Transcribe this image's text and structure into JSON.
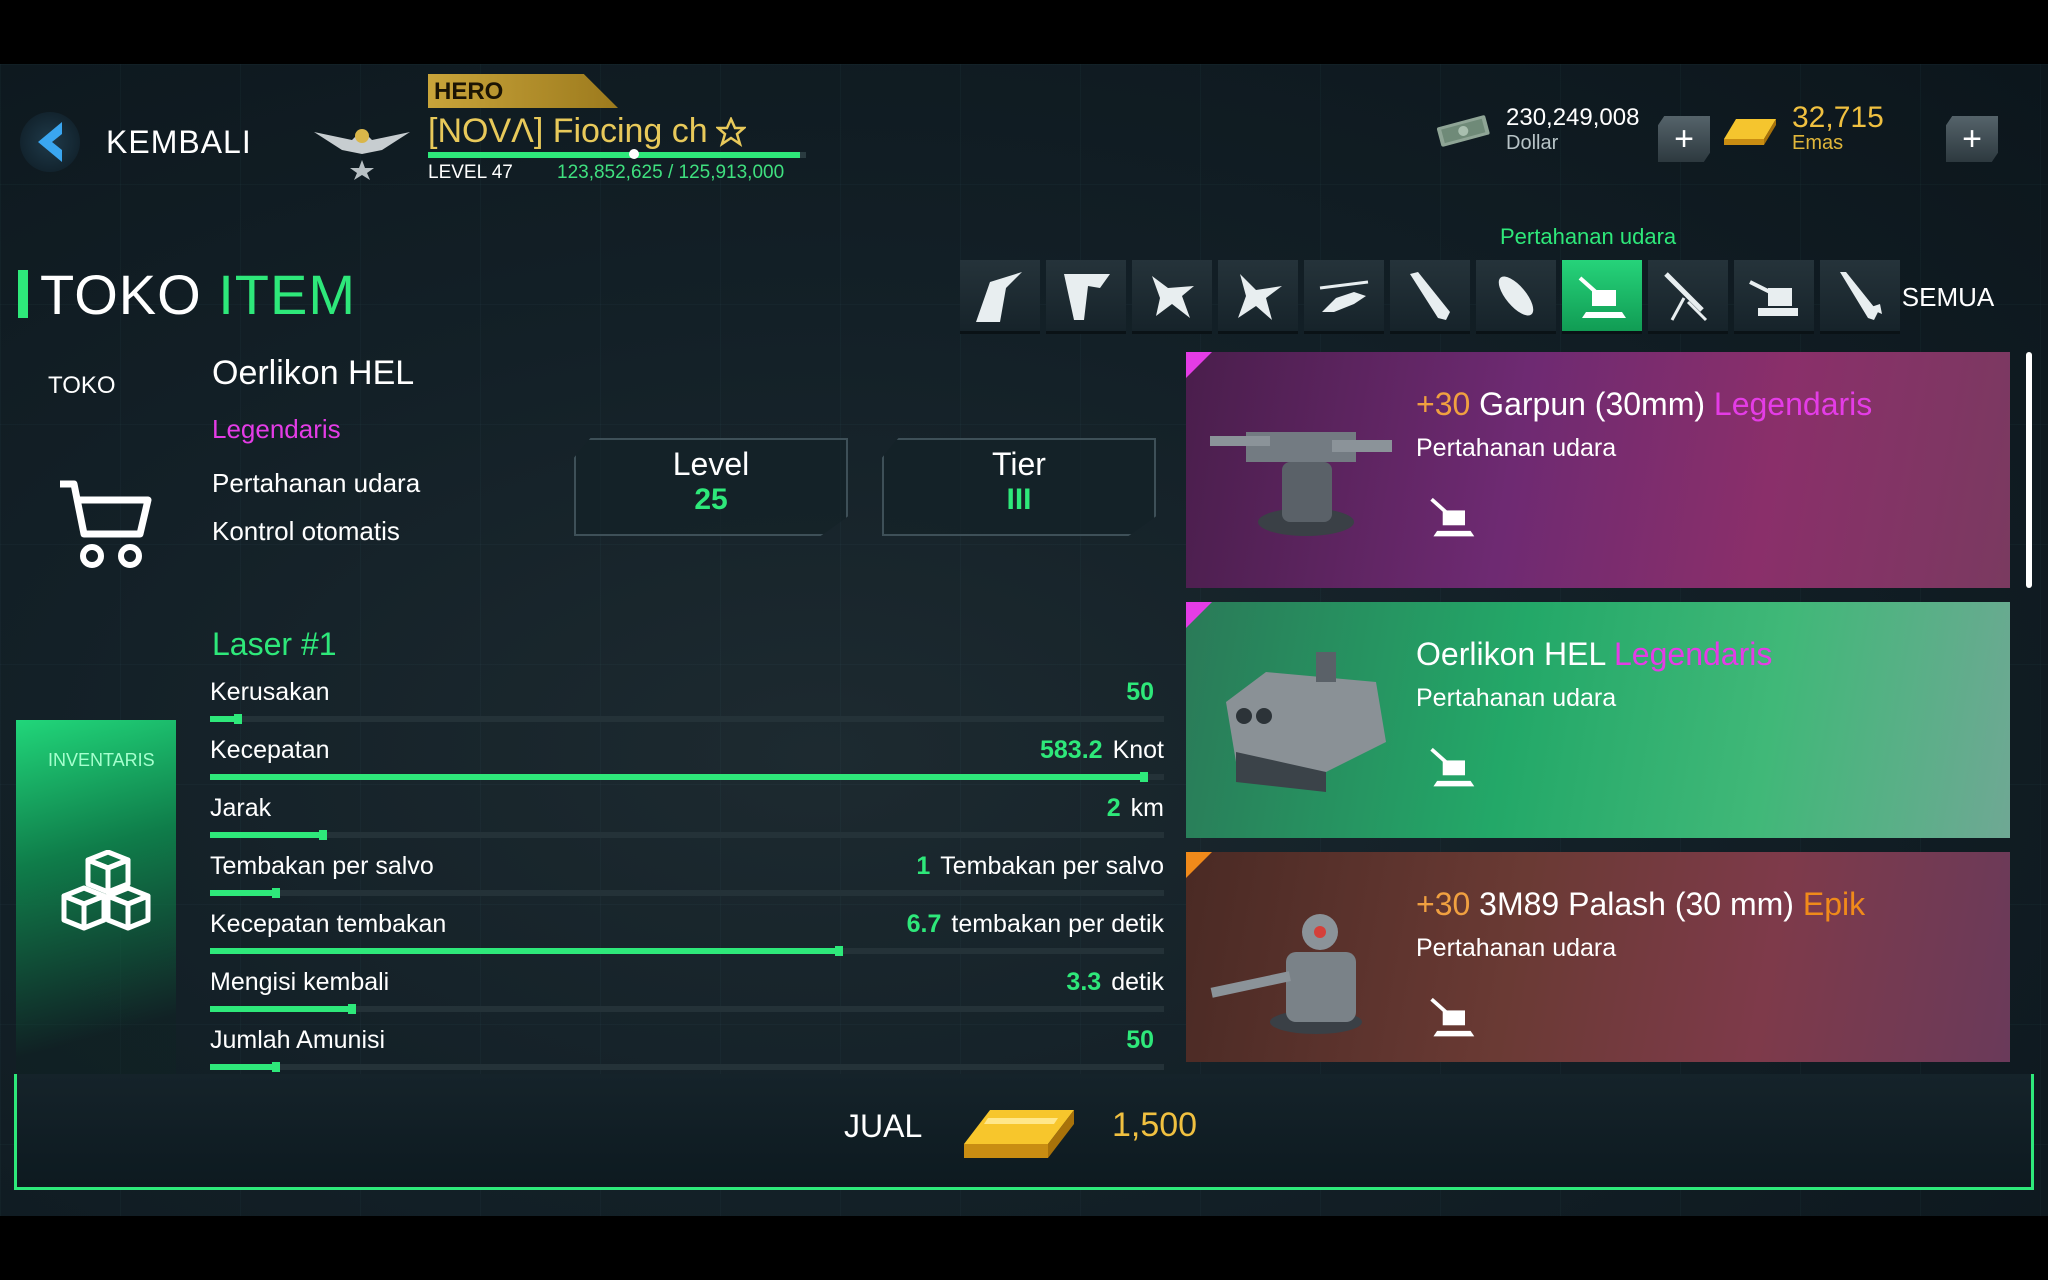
{
  "header": {
    "back_label": "KEMBALI",
    "hero_tag": "HERO",
    "player_name": "[NOVΛ] Fiocing ch",
    "level": "LEVEL 47",
    "xp": "123,852,625 / 125,913,000",
    "xp_progress": 0.9836,
    "dollar_value": "230,249,008",
    "dollar_label": "Dollar",
    "gold_value": "32,715",
    "gold_label": "Emas",
    "plus": "+"
  },
  "page": {
    "title_a": "TOKO",
    "title_b": "ITEM",
    "category_caption": "Pertahanan udara",
    "category_all": "SEMUA",
    "categories": [
      "fighter-jet-icon",
      "stealth-bomber-icon",
      "jet-icon",
      "interceptor-icon",
      "helicopter-icon",
      "missile-icon",
      "bomb-icon",
      "anti-air-icon",
      "machine-gun-icon",
      "turret-icon",
      "rocket-icon"
    ],
    "active_category": "anti-air-icon"
  },
  "nav": {
    "shop": "TOKO",
    "inventory": "INVENTARIS"
  },
  "item": {
    "name": "Oerlikon HEL",
    "rarity": "Legendaris",
    "type": "Pertahanan udara",
    "control": "Kontrol otomatis",
    "level_label": "Level",
    "level_value": "25",
    "tier_label": "Tier",
    "tier_value": "III",
    "weapon_name": "Laser",
    "weapon_index": "#1",
    "stats": [
      {
        "name": "Kerusakan",
        "value": "50",
        "unit": "",
        "fill": 0.03
      },
      {
        "name": "Kecepatan",
        "value": "583.2",
        "unit": "Knot",
        "fill": 0.98
      },
      {
        "name": "Jarak",
        "value": "2",
        "unit": "km",
        "fill": 0.12
      },
      {
        "name": "Tembakan per salvo",
        "value": "1",
        "unit": "Tembakan per salvo",
        "fill": 0.07
      },
      {
        "name": "Kecepatan tembakan",
        "value": "6.7",
        "unit": "tembakan per detik",
        "fill": 0.66
      },
      {
        "name": "Mengisi kembali",
        "value": "3.3",
        "unit": "detik",
        "fill": 0.15
      },
      {
        "name": "Jumlah Amunisi",
        "value": "50",
        "unit": "",
        "fill": 0.07
      }
    ]
  },
  "list": [
    {
      "prefix": "+30",
      "name": "Garpun (30mm)",
      "rarity": "Legendaris",
      "type": "Pertahanan udara"
    },
    {
      "prefix": "",
      "name": "Oerlikon HEL",
      "rarity": "Legendaris",
      "type": "Pertahanan udara"
    },
    {
      "prefix": "+30",
      "name": "3M89 Palash (30 mm)",
      "rarity": "Epik",
      "type": "Pertahanan udara"
    }
  ],
  "sell": {
    "label": "JUAL",
    "price": "1,500"
  },
  "colors": {
    "accent": "#2ee87a",
    "legendary": "#e43ce6",
    "epic": "#f08a1a",
    "gold": "#f0c040"
  }
}
